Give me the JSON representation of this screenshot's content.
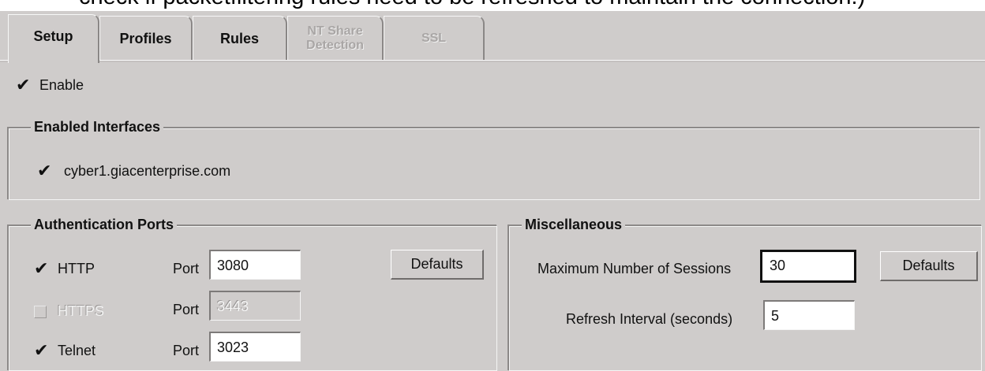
{
  "caption": {
    "text": "check if packetfiltering rules need to be refreshed to maintain the connection.)"
  },
  "tabs": [
    {
      "label": "Setup",
      "active": true,
      "enabled": true
    },
    {
      "label": "Profiles",
      "active": false,
      "enabled": true
    },
    {
      "label": "Rules",
      "active": false,
      "enabled": true
    },
    {
      "label": "NT Share Detection",
      "active": false,
      "enabled": false
    },
    {
      "label": "SSL",
      "active": false,
      "enabled": false
    }
  ],
  "enable": {
    "label": "Enable",
    "checked": true
  },
  "interfaces": {
    "title": "Enabled Interfaces",
    "items": [
      {
        "label": "cyber1.giacenterprise.com",
        "checked": true
      }
    ]
  },
  "auth_ports": {
    "title": "Authentication Ports",
    "port_label": "Port",
    "defaults_label": "Defaults",
    "rows": [
      {
        "protocol": "HTTP",
        "checked": true,
        "enabled": true,
        "port": "3080"
      },
      {
        "protocol": "HTTPS",
        "checked": false,
        "enabled": false,
        "port": "3443"
      },
      {
        "protocol": "Telnet",
        "checked": true,
        "enabled": true,
        "port": "3023"
      }
    ]
  },
  "misc": {
    "title": "Miscellaneous",
    "max_sessions_label": "Maximum Number of Sessions",
    "max_sessions": "30",
    "refresh_label": "Refresh Interval (seconds)",
    "refresh": "5",
    "defaults_label": "Defaults"
  },
  "icons": {
    "check": "check-icon"
  }
}
